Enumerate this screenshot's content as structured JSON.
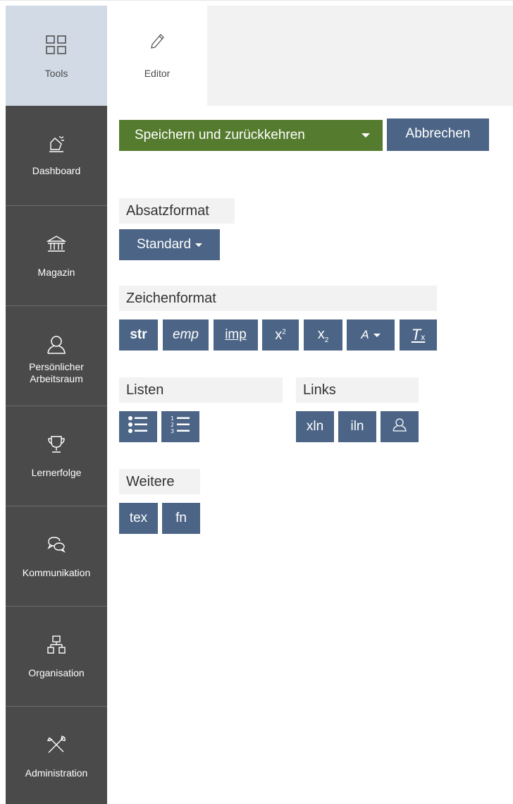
{
  "sidebar": {
    "items": [
      {
        "label": "Tools",
        "icon": "grid-icon"
      },
      {
        "label": "Dashboard",
        "icon": "dashboard-icon"
      },
      {
        "label": "Magazin",
        "icon": "bank-icon"
      },
      {
        "label": "Persönlicher\nArbeitsraum",
        "icon": "person-icon"
      },
      {
        "label": "Lernerfolge",
        "icon": "trophy-icon"
      },
      {
        "label": "Kommunikation",
        "icon": "chat-icon"
      },
      {
        "label": "Organisation",
        "icon": "org-chart-icon"
      },
      {
        "label": "Administration",
        "icon": "tools-icon"
      }
    ]
  },
  "tabs": {
    "editor_label": "Editor"
  },
  "toolbar": {
    "save_label": "Speichern und zurückkehren",
    "cancel_label": "Abbrechen"
  },
  "paragraph": {
    "title": "Absatzformat",
    "select_value": "Standard"
  },
  "character": {
    "title": "Zeichenformat",
    "buttons": [
      "str",
      "emp",
      "imp",
      "x²",
      "x₂",
      "A",
      "Tx"
    ]
  },
  "lists": {
    "title": "Listen"
  },
  "links": {
    "title": "Links",
    "buttons": [
      "xln",
      "iln"
    ]
  },
  "more": {
    "title": "Weitere",
    "buttons": [
      "tex",
      "fn"
    ]
  },
  "colors": {
    "sidebar_bg": "#4a4a4a",
    "sidebar_active": "#d1dae5",
    "save_green": "#557b2e",
    "button_blue": "#4c6586"
  }
}
